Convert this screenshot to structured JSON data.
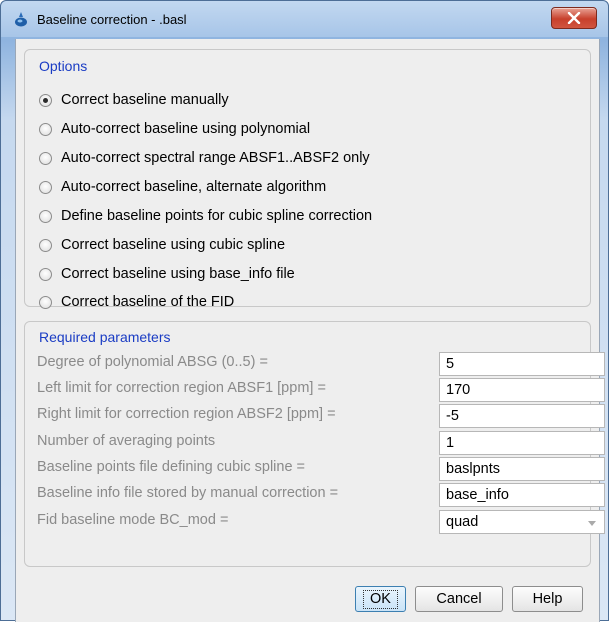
{
  "window": {
    "title": "Baseline correction - .basl",
    "icon": "topspin-app-icon"
  },
  "options": {
    "title": "Options",
    "selected_index": 0,
    "items": [
      {
        "label": "Correct baseline manually",
        "checked": true
      },
      {
        "label": "Auto-correct baseline using polynomial",
        "checked": false
      },
      {
        "label": "Auto-correct spectral range ABSF1..ABSF2 only",
        "checked": false
      },
      {
        "label": "Auto-correct baseline, alternate algorithm",
        "checked": false
      },
      {
        "label": "Define baseline points for cubic spline correction",
        "checked": false
      },
      {
        "label": "Correct baseline using cubic spline",
        "checked": false
      },
      {
        "label": "Correct baseline using base_info file",
        "checked": false
      },
      {
        "label": "Correct baseline of the FID",
        "checked": false
      }
    ]
  },
  "params": {
    "title": "Required parameters",
    "rows": [
      {
        "label": "Degree of polynomial ABSG (0..5) =",
        "value": "5"
      },
      {
        "label": "Left limit for correction region ABSF1 [ppm] =",
        "value": "170"
      },
      {
        "label": "Right limit for correction region ABSF2 [ppm] =",
        "value": "-5"
      },
      {
        "label": "Number of averaging points",
        "value": "1"
      },
      {
        "label": "Baseline points file defining cubic spline =",
        "value": "baslpnts"
      },
      {
        "label": "Baseline info file stored by manual correction =",
        "value": "base_info"
      }
    ],
    "fid_mode": {
      "label": "Fid baseline mode BC_mod =",
      "value": "quad"
    }
  },
  "buttons": {
    "ok": "OK",
    "cancel": "Cancel",
    "help": "Help"
  },
  "colors": {
    "group_title": "#1a3cc4",
    "disabled_label": "#8a8a8a",
    "client_bg": "#eeeeee"
  }
}
